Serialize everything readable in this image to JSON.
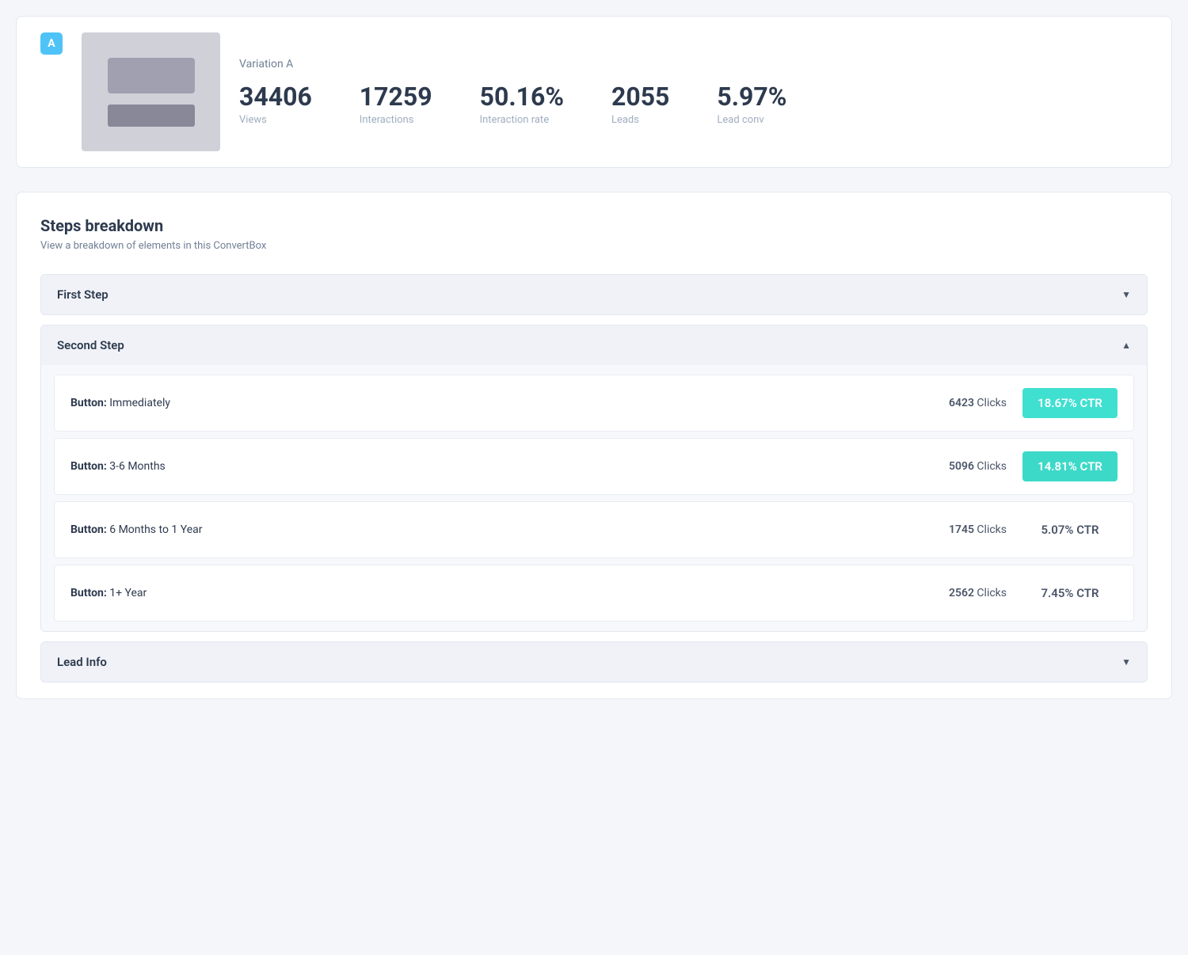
{
  "variation": {
    "badge": "A",
    "name": "Variation A",
    "stats": [
      {
        "value": "34406",
        "label": "Views"
      },
      {
        "value": "17259",
        "label": "Interactions"
      },
      {
        "value": "50.16%",
        "label": "Interaction rate"
      },
      {
        "value": "2055",
        "label": "Leads"
      },
      {
        "value": "5.97%",
        "label": "Lead conv"
      }
    ]
  },
  "steps_section": {
    "title": "Steps breakdown",
    "subtitle": "View a breakdown of elements in this ConvertBox"
  },
  "steps": [
    {
      "id": "first-step",
      "title": "First Step",
      "expanded": false,
      "buttons": []
    },
    {
      "id": "second-step",
      "title": "Second Step",
      "expanded": true,
      "buttons": [
        {
          "label_prefix": "Button:",
          "label_text": "Immediately",
          "clicks": "6423",
          "clicks_label": "Clicks",
          "ctr": "18.67% CTR",
          "highlight": "highlight-1"
        },
        {
          "label_prefix": "Button:",
          "label_text": "3-6 Months",
          "clicks": "5096",
          "clicks_label": "Clicks",
          "ctr": "14.81% CTR",
          "highlight": "highlight-2"
        },
        {
          "label_prefix": "Button:",
          "label_text": "6 Months to 1 Year",
          "clicks": "1745",
          "clicks_label": "Clicks",
          "ctr": "5.07% CTR",
          "highlight": "normal"
        },
        {
          "label_prefix": "Button:",
          "label_text": "1+ Year",
          "clicks": "2562",
          "clicks_label": "Clicks",
          "ctr": "7.45% CTR",
          "highlight": "normal"
        }
      ]
    }
  ],
  "lead_info": {
    "title": "Lead Info"
  },
  "icons": {
    "chevron_down": "▼",
    "chevron_up": "▲"
  }
}
